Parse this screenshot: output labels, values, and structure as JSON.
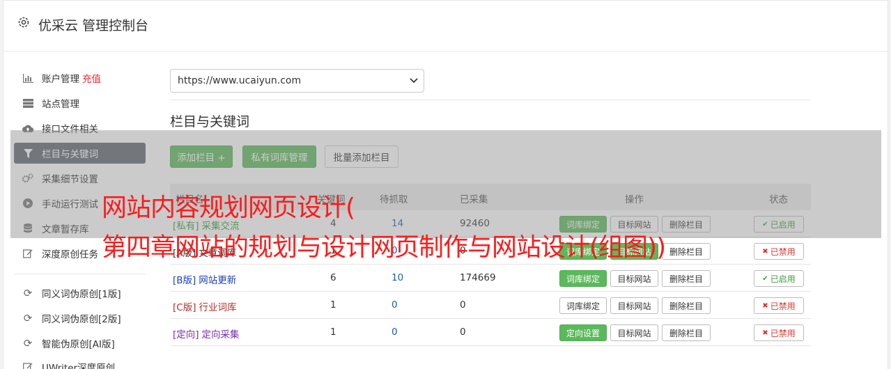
{
  "header": {
    "title": "优采云 管理控制台",
    "icon": "gear-icon"
  },
  "sidebar": {
    "items": [
      {
        "label": "账户管理",
        "extra": "充值",
        "icon": "bar-chart-icon"
      },
      {
        "label": "站点管理",
        "icon": "server-icon"
      },
      {
        "label": "接口文件相关",
        "icon": "cloud-upload-icon"
      },
      {
        "label": "栏目与关键词",
        "icon": "filter-icon",
        "active": true
      },
      {
        "label": "采集细节设置",
        "icon": "cogs-icon"
      },
      {
        "label": "手动运行测试",
        "icon": "play-icon"
      },
      {
        "label": "文章暂存库",
        "icon": "database-icon"
      },
      {
        "label": "深度原创任务",
        "icon": "edit-icon"
      },
      {
        "label": "同义词伪原创[1版]",
        "icon": "refresh-icon"
      },
      {
        "label": "同义词伪原创[2版]",
        "icon": "refresh-icon"
      },
      {
        "label": "智能伪原创[AI版]",
        "icon": "refresh-icon"
      },
      {
        "label": "UWriter深度原创",
        "icon": "edit-icon"
      }
    ]
  },
  "site_select": {
    "value": "https://www.ucaiyun.com"
  },
  "section": {
    "title": "栏目与关键词"
  },
  "toolbar": {
    "add_column": "添加栏目 +",
    "private_lib": "私有词库管理",
    "batch_add": "批量添加栏目"
  },
  "table": {
    "headers": {
      "name": "栏目名",
      "keywords": "关键词",
      "fetched": "待抓取",
      "collected": "已采集",
      "ops": "操作",
      "status": "状态"
    },
    "rows": [
      {
        "tag": "[私有]",
        "name": "采集交流",
        "keywords": "4",
        "fetched": "14",
        "collected": "92460",
        "op1": "词库绑定",
        "op2": "目标网站",
        "op3": "删除栏目",
        "status": "已启用",
        "color": "#3c9a3c"
      },
      {
        "tag": "[A版]",
        "name": "文章调库",
        "keywords": "1",
        "fetched": "0",
        "collected": "0",
        "op1": "词库绑定",
        "op2": "目标网站",
        "op3": "删除栏目",
        "status": "已禁用",
        "color": "#333333"
      },
      {
        "tag": "[B版]",
        "name": "网站更新",
        "keywords": "6",
        "fetched": "10",
        "collected": "174669",
        "op1": "词库绑定",
        "op2": "目标网站",
        "op3": "删除栏目",
        "status": "已启用",
        "color": "#1a3fbf"
      },
      {
        "tag": "[C版]",
        "name": "行业词库",
        "keywords": "1",
        "fetched": "0",
        "collected": "0",
        "op1": "词库绑定",
        "op2": "目标网站",
        "op3": "删除栏目",
        "status": "已禁用",
        "color": "#b2302a"
      },
      {
        "tag": "[定向]",
        "name": "定向采集",
        "keywords": "1",
        "fetched": "0",
        "collected": "0",
        "op1": "定向设置",
        "op2": "目标网站",
        "op3": "删除栏目",
        "status": "已禁用",
        "color": "#7a2bb5"
      }
    ]
  },
  "overlay": {
    "line1": "网站内容规划网页设计(",
    "line2": "第四章网站的规划与设计网页制作与网站设计(组图))"
  },
  "colors": {
    "green": "#5cb85c",
    "active_bg": "#5f6770",
    "red_text": "#ff1a1a"
  }
}
